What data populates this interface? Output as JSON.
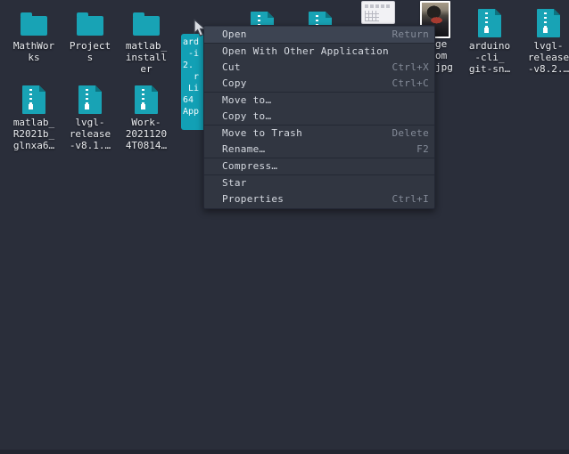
{
  "desktop": {
    "icons": [
      {
        "id": "mathworks",
        "type": "folder",
        "label": "MathWor\nks"
      },
      {
        "id": "projects",
        "type": "folder",
        "label": "Project\ns"
      },
      {
        "id": "matlab-installer",
        "type": "folder",
        "label": "matlab_\ninstall\ner"
      },
      {
        "id": "appimage-selected",
        "type": "file-selected",
        "label": "ard\n -i\n2.\n  r\n Li\n64\nApp"
      },
      {
        "id": "archive-partial-1",
        "type": "archive",
        "label": ""
      },
      {
        "id": "archive-partial-2",
        "type": "archive",
        "label": ""
      },
      {
        "id": "document-preview",
        "type": "document",
        "label": ""
      },
      {
        "id": "photo-jpg",
        "type": "photo",
        "label": "ge\nom\njpg"
      },
      {
        "id": "arduino-cli",
        "type": "archive",
        "label": "arduino\n-cli_\ngit-sn…"
      },
      {
        "id": "lvgl-v8-2",
        "type": "archive",
        "label": "lvgl-\nrelease\n-v8.2.…"
      },
      {
        "id": "matlab-r2021b",
        "type": "archive",
        "label": "matlab_\nR2021b_\nglnxa6…"
      },
      {
        "id": "lvgl-v8-1",
        "type": "archive",
        "label": "lvgl-\nrelease\n-v8.1.…"
      },
      {
        "id": "work-zip",
        "type": "archive",
        "label": "Work-\n2021120\n4T0814…"
      }
    ]
  },
  "context_menu": {
    "items": [
      {
        "label": "Open",
        "shortcut": "Return"
      },
      {
        "label": "Open With Other Application",
        "shortcut": ""
      },
      {
        "label": "Cut",
        "shortcut": "Ctrl+X"
      },
      {
        "label": "Copy",
        "shortcut": "Ctrl+C"
      },
      {
        "label": "Move to…",
        "shortcut": ""
      },
      {
        "label": "Copy to…",
        "shortcut": ""
      },
      {
        "label": "Move to Trash",
        "shortcut": "Delete"
      },
      {
        "label": "Rename…",
        "shortcut": "F2"
      },
      {
        "label": "Compress…",
        "shortcut": ""
      },
      {
        "label": "Star",
        "shortcut": ""
      },
      {
        "label": "Properties",
        "shortcut": "Ctrl+I"
      }
    ]
  },
  "colors": {
    "desktop_background": "#2a2e3a",
    "menu_background": "#313641",
    "menu_highlight": "#3d4452",
    "menu_text": "#d6dae1",
    "menu_shortcut_text": "#848b98",
    "icon_teal": "#18a3b5",
    "fold_dark_teal": "#0c7380",
    "selection_teal": "#12a0b5",
    "label_text": "#e8eaee"
  }
}
